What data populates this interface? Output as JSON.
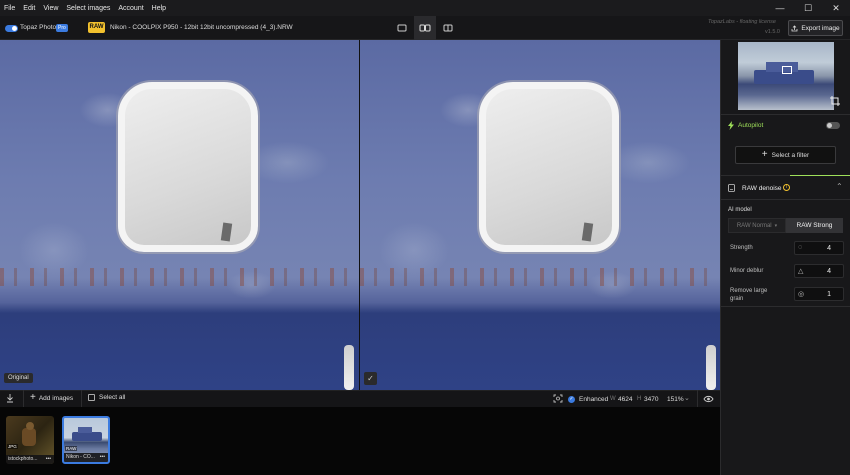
{
  "menubar": {
    "items": [
      "File",
      "Edit",
      "View",
      "Select images",
      "Account",
      "Help"
    ]
  },
  "window_controls": {
    "minimize": "—",
    "maximize": "☐",
    "close": "✕"
  },
  "toolbar": {
    "app_name": "Topaz Photo",
    "pro_badge": "Pro",
    "raw_badge": "RAW",
    "file_name": "Nikon - COOLPIX P950 - 12bit 12bit uncompressed (4_3).NRW",
    "license": "TopazLabs - floating license",
    "version": "v1.5.0",
    "export_label": "Export image"
  },
  "preview": {
    "original_label": "Original",
    "check_symbol": "✓"
  },
  "bottombar": {
    "add_images": "Add images",
    "select_all": "Select all",
    "enhanced": "Enhanced",
    "w_label": "W",
    "width": "4624",
    "h_label": "H",
    "height": "3470",
    "zoom": "151%"
  },
  "filmstrip": {
    "items": [
      {
        "label": "istockphoto...",
        "more": "•••",
        "badge": "JPG"
      },
      {
        "label": "Nikon - CO...",
        "more": "•••",
        "badge": "RAW"
      }
    ]
  },
  "right_panel": {
    "autopilot": "Autopilot",
    "select_filter": "Select a filter",
    "filter_title": "RAW denoise",
    "ai_model_label": "AI model",
    "model_options": [
      "RAW Normal",
      "RAW Strong"
    ],
    "strength_label": "Strength",
    "strength_value": "4",
    "deblur_label": "Minor deblur",
    "deblur_value": "4",
    "grain_label": "Remove large grain",
    "grain_value": "1"
  },
  "colors": {
    "accent": "#3b7be0",
    "raw": "#f2c12e",
    "autopilot": "#9fe05a"
  }
}
